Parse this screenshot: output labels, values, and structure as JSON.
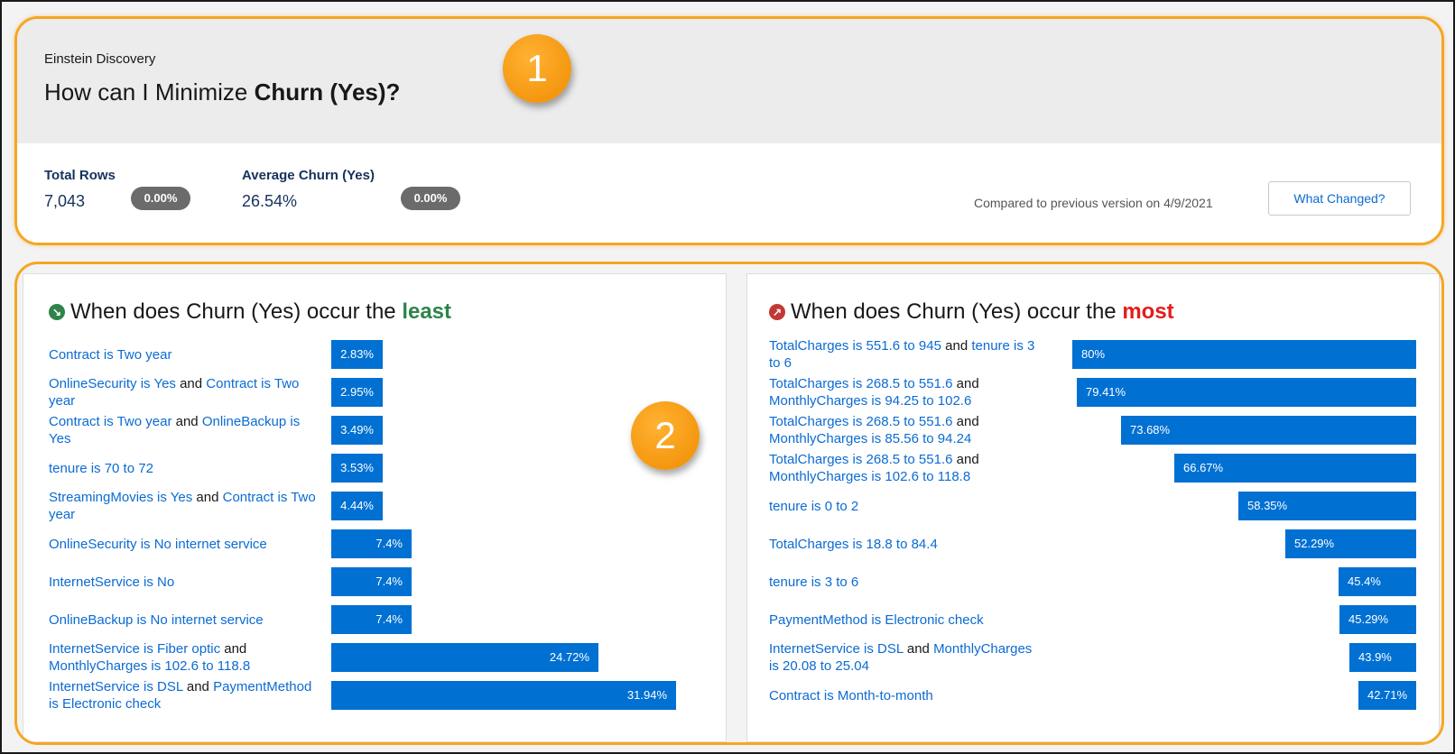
{
  "header": {
    "app_name": "Einstein Discovery",
    "title_prefix": "How can I Minimize ",
    "title_target": "Churn (Yes)?"
  },
  "metrics": [
    {
      "label": "Total Rows",
      "value": "7,043",
      "change": "0.00%"
    },
    {
      "label": "Average Churn (Yes)",
      "value": "26.54%",
      "change": "0.00%"
    }
  ],
  "compare_text": "Compared to previous version on 4/9/2021",
  "what_changed_label": "What Changed?",
  "callouts": [
    "1",
    "2"
  ],
  "colors": {
    "bar": "#0070d2",
    "link": "#0b6bd3",
    "least": "#2e844a",
    "most": "#e41c1c",
    "callout": "#f5a623"
  },
  "least": {
    "title_prefix": "When does Churn (Yes) occur the ",
    "title_emphasis": "least",
    "icon": "arrow-down-right-icon",
    "rows": [
      {
        "parts": [
          {
            "t": "Contract is Two year",
            "link": true
          }
        ],
        "value": 2.83,
        "label": "2.83%"
      },
      {
        "parts": [
          {
            "t": "OnlineSecurity is Yes",
            "link": true
          },
          {
            "t": " and ",
            "link": false
          },
          {
            "t": "Contract is Two year",
            "link": true
          }
        ],
        "value": 2.95,
        "label": "2.95%"
      },
      {
        "parts": [
          {
            "t": "Contract is Two year",
            "link": true
          },
          {
            "t": " and ",
            "link": false
          },
          {
            "t": "OnlineBackup is Yes",
            "link": true
          }
        ],
        "value": 3.49,
        "label": "3.49%"
      },
      {
        "parts": [
          {
            "t": "tenure is 70 to 72",
            "link": true
          }
        ],
        "value": 3.53,
        "label": "3.53%"
      },
      {
        "parts": [
          {
            "t": "StreamingMovies is Yes",
            "link": true
          },
          {
            "t": " and ",
            "link": false
          },
          {
            "t": "Contract is Two year",
            "link": true
          }
        ],
        "value": 4.44,
        "label": "4.44%"
      },
      {
        "parts": [
          {
            "t": "OnlineSecurity is No internet service",
            "link": true
          }
        ],
        "value": 7.4,
        "label": "7.4%"
      },
      {
        "parts": [
          {
            "t": "InternetService is No",
            "link": true
          }
        ],
        "value": 7.4,
        "label": "7.4%"
      },
      {
        "parts": [
          {
            "t": "OnlineBackup is No internet service",
            "link": true
          }
        ],
        "value": 7.4,
        "label": "7.4%"
      },
      {
        "parts": [
          {
            "t": "InternetService is Fiber optic",
            "link": true
          },
          {
            "t": " and ",
            "link": false
          },
          {
            "t": "MonthlyCharges is 102.6 to 118.8",
            "link": true
          }
        ],
        "value": 24.72,
        "label": "24.72%"
      },
      {
        "parts": [
          {
            "t": "InternetService is DSL",
            "link": true
          },
          {
            "t": " and ",
            "link": false
          },
          {
            "t": "PaymentMethod is Electronic check",
            "link": true
          }
        ],
        "value": 31.94,
        "label": "31.94%"
      }
    ]
  },
  "most": {
    "title_prefix": "When does Churn (Yes) occur the ",
    "title_emphasis": "most",
    "icon": "arrow-up-right-icon",
    "rows": [
      {
        "parts": [
          {
            "t": "TotalCharges is 551.6 to 945",
            "link": true
          },
          {
            "t": " and ",
            "link": false
          },
          {
            "t": "tenure is 3 to 6",
            "link": true
          }
        ],
        "value": 80,
        "label": "80%"
      },
      {
        "parts": [
          {
            "t": "TotalCharges is 268.5 to 551.6",
            "link": true
          },
          {
            "t": " and ",
            "link": false
          },
          {
            "t": "MonthlyCharges is 94.25 to 102.6",
            "link": true
          }
        ],
        "value": 79.41,
        "label": "79.41%"
      },
      {
        "parts": [
          {
            "t": "TotalCharges is 268.5 to 551.6",
            "link": true
          },
          {
            "t": " and ",
            "link": false
          },
          {
            "t": "MonthlyCharges is 85.56 to 94.24",
            "link": true
          }
        ],
        "value": 73.68,
        "label": "73.68%"
      },
      {
        "parts": [
          {
            "t": "TotalCharges is 268.5 to 551.6",
            "link": true
          },
          {
            "t": " and ",
            "link": false
          },
          {
            "t": "MonthlyCharges is 102.6 to 118.8",
            "link": true
          }
        ],
        "value": 66.67,
        "label": "66.67%"
      },
      {
        "parts": [
          {
            "t": "tenure is 0 to 2",
            "link": true
          }
        ],
        "value": 58.35,
        "label": "58.35%"
      },
      {
        "parts": [
          {
            "t": "TotalCharges is 18.8 to 84.4",
            "link": true
          }
        ],
        "value": 52.29,
        "label": "52.29%"
      },
      {
        "parts": [
          {
            "t": "tenure is 3 to 6",
            "link": true
          }
        ],
        "value": 45.4,
        "label": "45.4%"
      },
      {
        "parts": [
          {
            "t": "PaymentMethod is Electronic check",
            "link": true
          }
        ],
        "value": 45.29,
        "label": "45.29%"
      },
      {
        "parts": [
          {
            "t": "InternetService is DSL",
            "link": true
          },
          {
            "t": " and ",
            "link": false
          },
          {
            "t": "MonthlyCharges is 20.08 to 25.04",
            "link": true
          }
        ],
        "value": 43.9,
        "label": "43.9%"
      },
      {
        "parts": [
          {
            "t": "Contract is Month-to-month",
            "link": true
          }
        ],
        "value": 42.71,
        "label": "42.71%"
      }
    ]
  }
}
